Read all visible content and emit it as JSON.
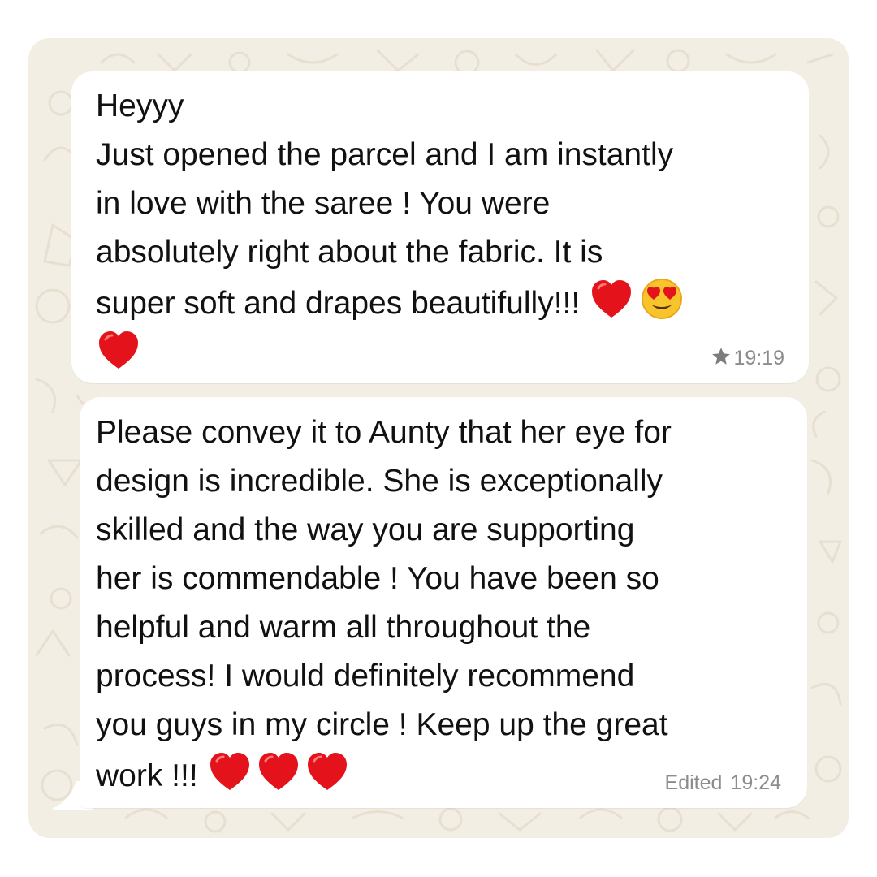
{
  "chat": {
    "wallpaper_color": "#f3eee4",
    "bubble_color": "#ffffff",
    "messages": [
      {
        "lines": [
          "Heyyy",
          "Just opened the parcel and I am instantly",
          "in love with the saree ! You were",
          "absolutely right about the fabric. It is",
          "super soft and drapes beautifully!!!"
        ],
        "emoji_inline": [
          "red-heart",
          "smiling-face-with-heart-eyes"
        ],
        "emoji_nextline": [
          "red-heart"
        ],
        "starred": true,
        "time": "19:19"
      },
      {
        "lines": [
          "Please convey it to Aunty that her eye for",
          "design is incredible. She is exceptionally",
          "skilled and the way you are supporting",
          "her is commendable ! You have been so",
          "helpful and warm all throughout the",
          "process! I would definitely recommend",
          "you guys in my circle ! Keep up the great",
          "work !!!"
        ],
        "emoji_inline": [
          "red-heart",
          "red-heart",
          "red-heart"
        ],
        "edited_label": "Edited",
        "time": "19:24"
      }
    ]
  }
}
